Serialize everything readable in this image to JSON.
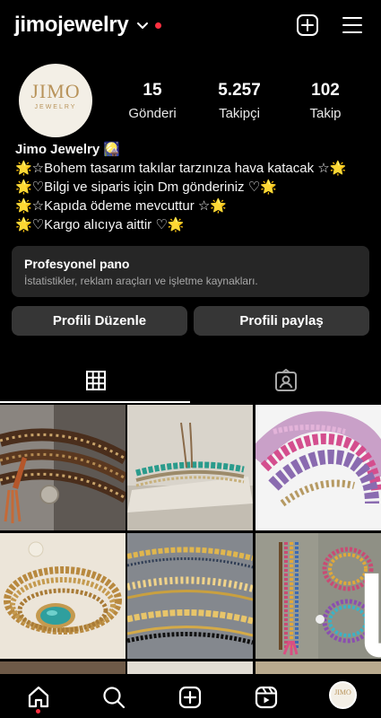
{
  "header": {
    "username": "jimojewelry",
    "icons": {
      "chevron": "chevron-down-icon",
      "create": "plus-square-icon",
      "menu": "hamburger-menu-icon"
    }
  },
  "profile": {
    "avatar_text": "JIMO",
    "avatar_subtext": "JEWELRY",
    "stats": [
      {
        "value": "15",
        "label": "Gönderi"
      },
      {
        "value": "5.257",
        "label": "Takipçi"
      },
      {
        "value": "102",
        "label": "Takip"
      }
    ],
    "name": "Jimo Jewelry 🎑",
    "bio_lines": [
      "🌟☆Bohem tasarım takılar tarzınıza hava katacak ☆🌟",
      "🌟♡Bilgi ve siparis için Dm gönderiniz ♡🌟",
      "🌟☆Kapıda ödeme mevcuttur ☆🌟",
      "🌟♡Kargo alıcıya aittir ♡🌟"
    ]
  },
  "professional_panel": {
    "title": "Profesyonel pano",
    "subtitle": "İstatistikler, reklam araçları ve işletme kaynakları."
  },
  "actions": {
    "edit_profile": "Profili Düzenle",
    "share_profile": "Profili paylaş"
  },
  "tabs": [
    {
      "name": "grid-icon",
      "selected": true
    },
    {
      "name": "tagged-icon",
      "selected": false
    }
  ],
  "posts": [
    {
      "subject": "leather wrap bracelet with tassel"
    },
    {
      "subject": "turquoise beaded bracelets on stone"
    },
    {
      "subject": "pink purple crystal bracelets"
    },
    {
      "subject": "gold chain bracelet with turquoise stone"
    },
    {
      "subject": "stacked gold chain bracelets"
    },
    {
      "subject": "colorful beaded bracelets with charms",
      "multi": true
    }
  ],
  "bottom_nav": [
    {
      "name": "home-icon",
      "active": true
    },
    {
      "name": "search-icon"
    },
    {
      "name": "create-icon"
    },
    {
      "name": "reels-icon"
    },
    {
      "name": "profile-avatar"
    }
  ],
  "colors": {
    "background": "#000000",
    "surface": "#262626",
    "button": "#363636",
    "notification": "#ff3040",
    "brand_gold": "#b8935a"
  }
}
